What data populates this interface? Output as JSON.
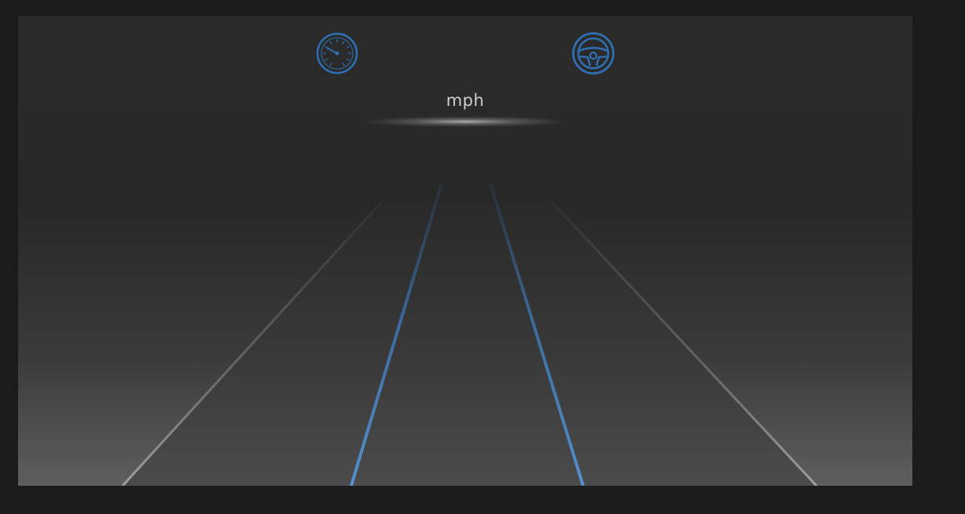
{
  "dashboard": {
    "speed_unit": "mph",
    "icons": {
      "speed": "speedometer-icon",
      "autopilot": "steering-wheel-icon"
    },
    "colors": {
      "accent": "#2f6fb3",
      "lane_blue": "#4a86c5",
      "edge_line": "#8a8a8a",
      "text": "#cfcfcf"
    }
  }
}
